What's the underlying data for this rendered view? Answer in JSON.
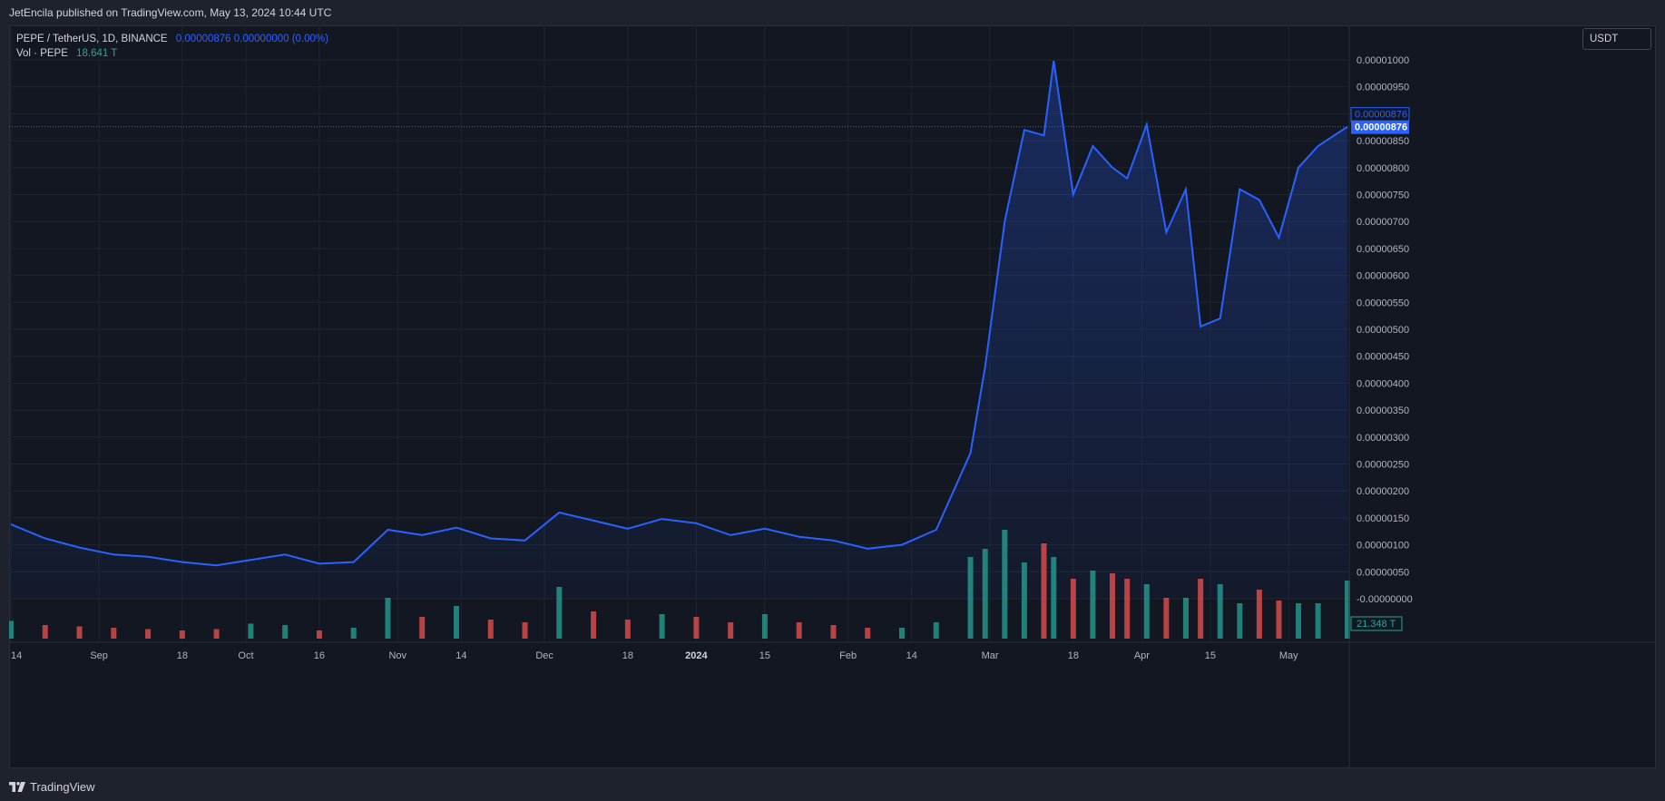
{
  "header": {
    "published": "JetEncila published on TradingView.com, May 13, 2024 10:44 UTC"
  },
  "legend": {
    "symbol": "PEPE / TetherUS, 1D, BINANCE",
    "values": "0.00000876  0.00000000 (0.00%)",
    "volume_label": "Vol · PEPE",
    "volume_value": "18.641 T"
  },
  "price_scale": {
    "currency": "USDT",
    "labels": [
      "0.00001000",
      "0.00000950",
      "0.00000850",
      "0.00000800",
      "0.00000750",
      "0.00000700",
      "0.00000650",
      "0.00000600",
      "0.00000550",
      "0.00000500",
      "0.00000450",
      "0.00000400",
      "0.00000350",
      "0.00000300",
      "0.00000250",
      "0.00000200",
      "0.00000150",
      "0.00000100",
      "0.00000050",
      "-0.00000000",
      "050"
    ],
    "last_price_label": "0.00000876",
    "last_price_highlight": "0.00000876",
    "volume_badge": "21.348 T"
  },
  "footer": {
    "brand": "TradingView"
  },
  "colors": {
    "line": "#2962ff",
    "up_volume": "#26a69a",
    "down_volume": "#ef5350",
    "background": "#131722"
  },
  "chart_data": {
    "type": "area",
    "title": "PEPE / TetherUS, 1D, BINANCE",
    "series_note": "approximate daily close, read from the chart",
    "x_tick_labels": [
      "14",
      "Sep",
      "18",
      "Oct",
      "16",
      "Nov",
      "14",
      "Dec",
      "18",
      "2024",
      "15",
      "Feb",
      "14",
      "Mar",
      "18",
      "Apr",
      "15",
      "May"
    ],
    "ylim": [
      -5e-07,
      1.02e-05
    ],
    "x": [
      "2023-08-14",
      "2023-08-21",
      "2023-08-28",
      "2023-09-04",
      "2023-09-11",
      "2023-09-18",
      "2023-09-25",
      "2023-10-02",
      "2023-10-09",
      "2023-10-16",
      "2023-10-23",
      "2023-10-30",
      "2023-11-06",
      "2023-11-13",
      "2023-11-20",
      "2023-11-27",
      "2023-12-04",
      "2023-12-11",
      "2023-12-18",
      "2023-12-25",
      "2024-01-01",
      "2024-01-08",
      "2024-01-15",
      "2024-01-22",
      "2024-01-29",
      "2024-02-05",
      "2024-02-12",
      "2024-02-19",
      "2024-02-26",
      "2024-02-29",
      "2024-03-04",
      "2024-03-08",
      "2024-03-12",
      "2024-03-14",
      "2024-03-18",
      "2024-03-22",
      "2024-03-26",
      "2024-03-29",
      "2024-04-02",
      "2024-04-06",
      "2024-04-10",
      "2024-04-13",
      "2024-04-17",
      "2024-04-21",
      "2024-04-25",
      "2024-04-29",
      "2024-05-03",
      "2024-05-07",
      "2024-05-13"
    ],
    "close": [
      1.38e-06,
      1.12e-06,
      9.5e-07,
      8.2e-07,
      7.8e-07,
      6.8e-07,
      6.2e-07,
      7.2e-07,
      8.2e-07,
      6.5e-07,
      6.8e-07,
      1.28e-06,
      1.18e-06,
      1.32e-06,
      1.12e-06,
      1.08e-06,
      1.6e-06,
      1.45e-06,
      1.3e-06,
      1.48e-06,
      1.4e-06,
      1.18e-06,
      1.3e-06,
      1.15e-06,
      1.08e-06,
      9.3e-07,
      1e-06,
      1.28e-06,
      2.7e-06,
      4.3e-06,
      7e-06,
      8.7e-06,
      8.6e-06,
      9.98e-06,
      7.5e-06,
      8.4e-06,
      8e-06,
      7.8e-06,
      8.8e-06,
      6.8e-06,
      7.6e-06,
      5.05e-06,
      5.2e-06,
      7.6e-06,
      7.4e-06,
      6.7e-06,
      8e-06,
      8.4e-06,
      8.76e-06
    ],
    "volume_trillions": [
      6.5,
      5.0,
      4.5,
      4.0,
      3.5,
      3.0,
      3.5,
      5.5,
      5.0,
      3.0,
      4.0,
      15.0,
      8.0,
      12.0,
      7.0,
      6.0,
      19.0,
      10.0,
      7.0,
      9.0,
      8.0,
      6.0,
      9.0,
      6.0,
      5.0,
      4.0,
      4.0,
      6.0,
      30.0,
      33.0,
      40.0,
      28.0,
      35.0,
      30.0,
      22.0,
      25.0,
      24.0,
      22.0,
      20.0,
      15.0,
      15.0,
      22.0,
      20.0,
      13.0,
      18.0,
      14.0,
      13.0,
      13.0,
      21.348
    ]
  }
}
